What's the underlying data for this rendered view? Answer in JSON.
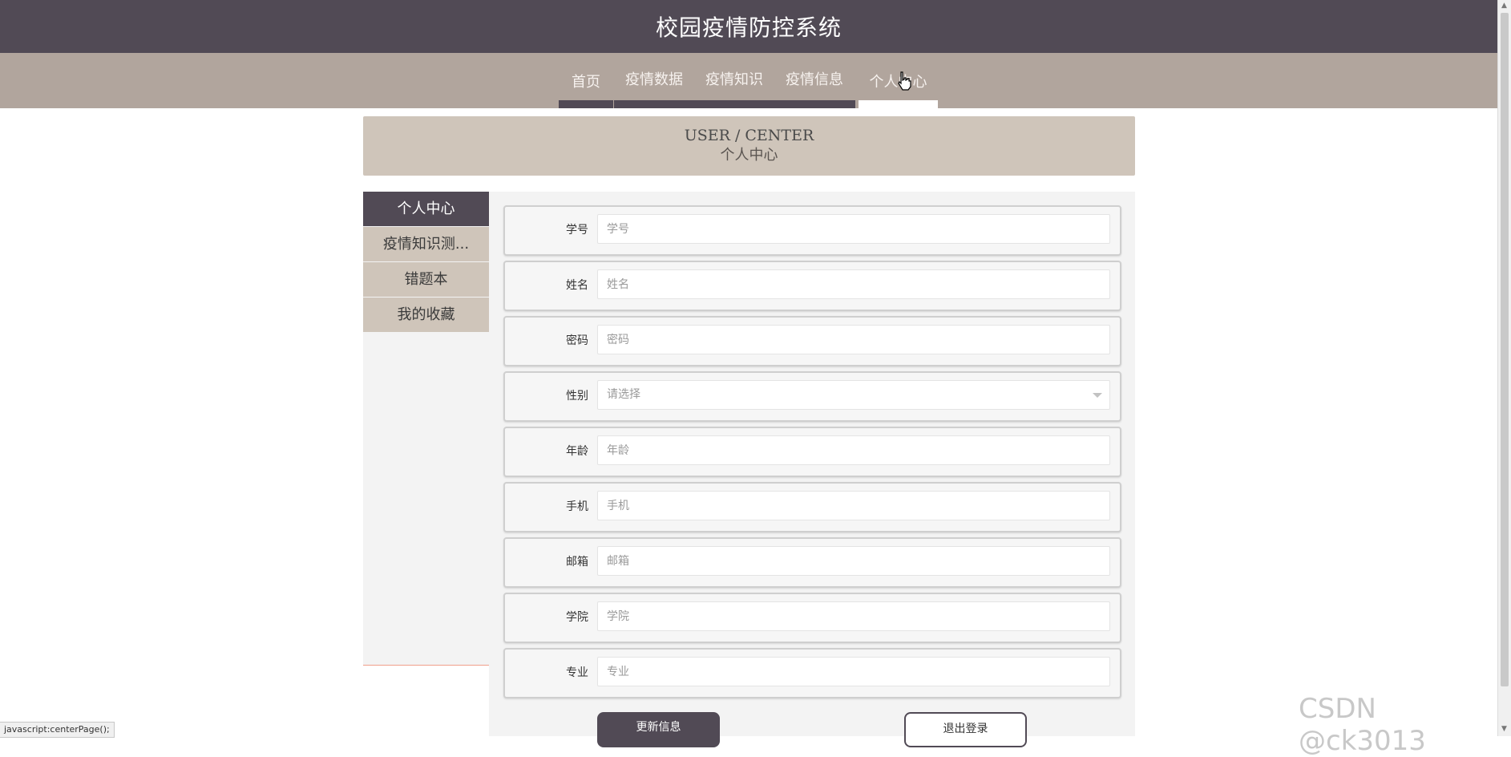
{
  "header": {
    "title": "校园疫情防控系统"
  },
  "nav": {
    "items": [
      {
        "label": "首页"
      },
      {
        "label": "疫情数据"
      },
      {
        "label": "疫情知识"
      },
      {
        "label": "疫情信息"
      },
      {
        "label": "个人中心",
        "active": true
      }
    ]
  },
  "banner": {
    "en": "USER / CENTER",
    "cn": "个人中心"
  },
  "sidebar": {
    "items": [
      {
        "label": "个人中心",
        "active": true
      },
      {
        "label": "疫情知识测..."
      },
      {
        "label": "错题本"
      },
      {
        "label": "我的收藏"
      }
    ]
  },
  "form": {
    "fields": [
      {
        "label": "学号",
        "placeholder": "学号"
      },
      {
        "label": "姓名",
        "placeholder": "姓名"
      },
      {
        "label": "密码",
        "placeholder": "密码"
      },
      {
        "label": "性别",
        "placeholder": "请选择",
        "type": "select"
      },
      {
        "label": "年龄",
        "placeholder": "年龄"
      },
      {
        "label": "手机",
        "placeholder": "手机"
      },
      {
        "label": "邮箱",
        "placeholder": "邮箱"
      },
      {
        "label": "学院",
        "placeholder": "学院"
      },
      {
        "label": "专业",
        "placeholder": "专业"
      }
    ],
    "update_label": "更新信息",
    "logout_label": "退出登录"
  },
  "statusbar": {
    "text": "javascript:centerPage();"
  },
  "watermark": {
    "text": "CSDN @ck3013"
  },
  "colors": {
    "primary": "#514a55",
    "nav_bg": "#b1a59d",
    "banner_bg": "#cfc5ba",
    "panel_bg": "#f3f3f3"
  }
}
